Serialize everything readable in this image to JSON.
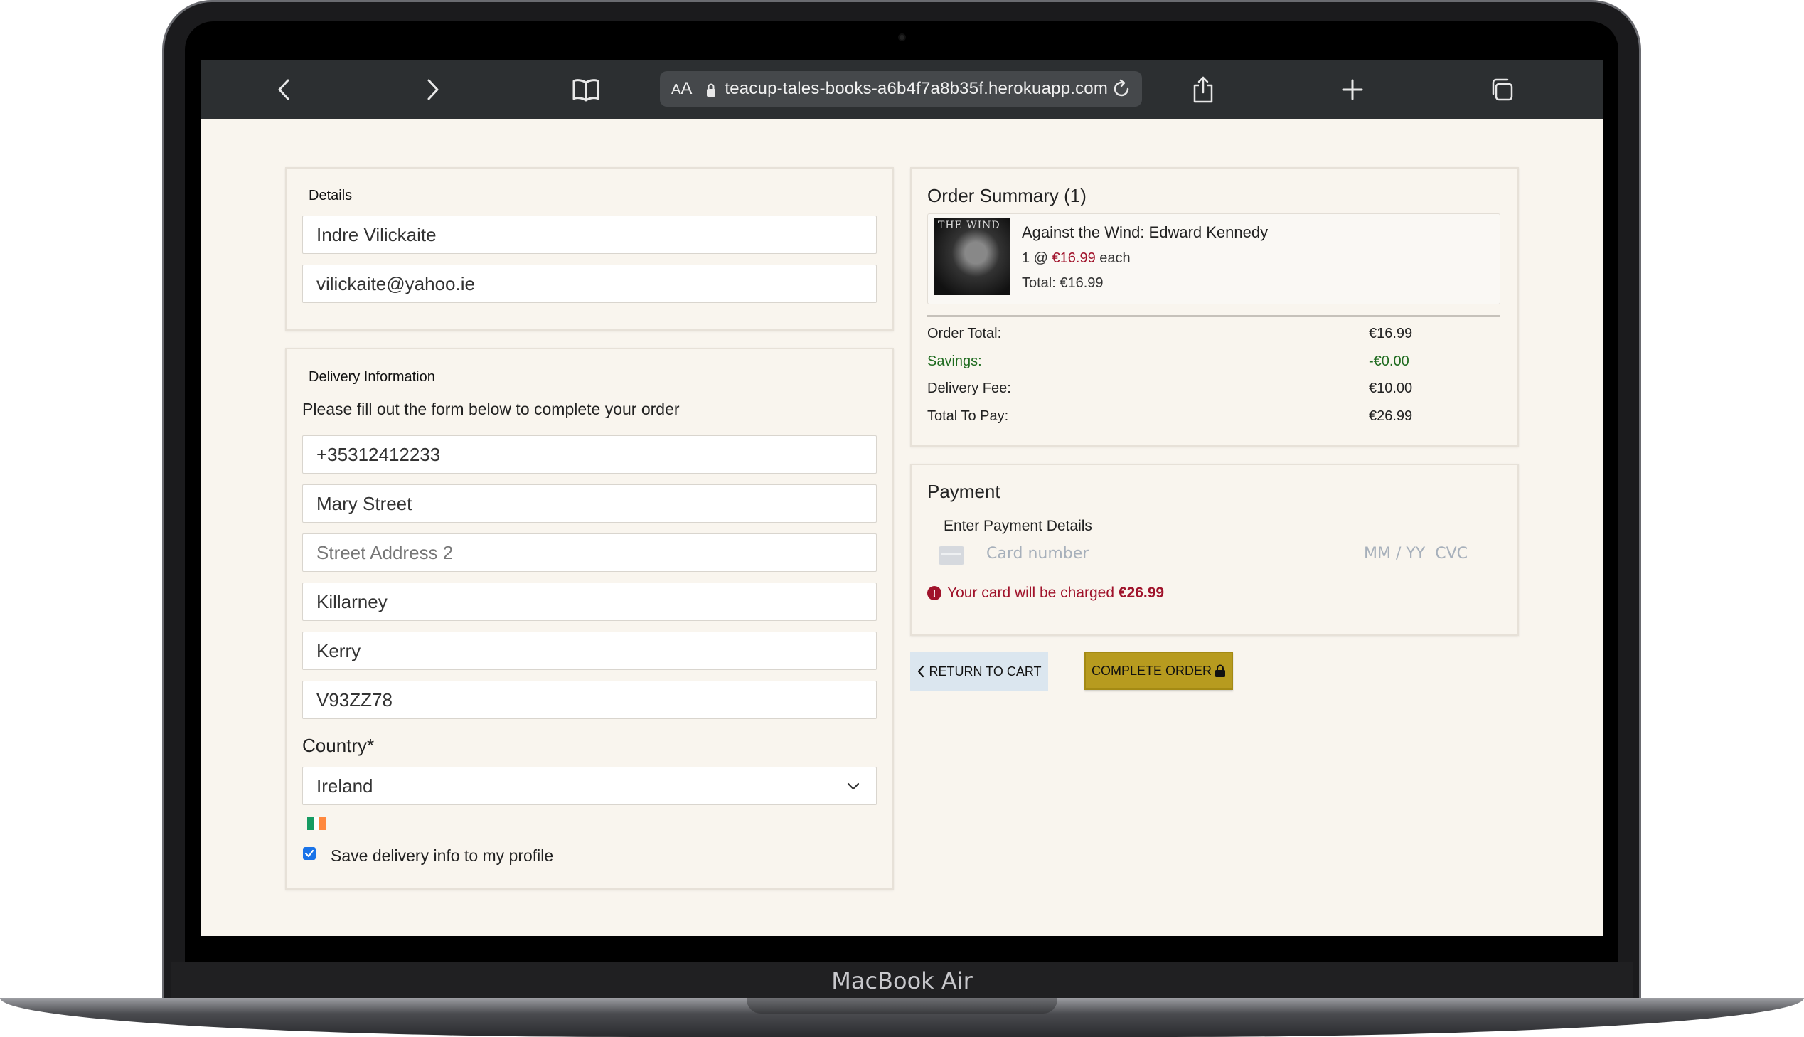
{
  "device": {
    "label": "MacBook Air"
  },
  "browser": {
    "aa_label_small": "A",
    "aa_label_big": "A",
    "url": "teacup-tales-books-a6b4f7a8b35f.herokuapp.com",
    "icons": [
      "back-icon",
      "forward-icon",
      "bookmarks-icon",
      "lock-icon",
      "reload-icon",
      "share-icon",
      "new-tab-icon",
      "tabs-icon"
    ]
  },
  "details": {
    "title": "Details",
    "full_name": "Indre Vilickaite",
    "email": "vilickaite@yahoo.ie"
  },
  "delivery": {
    "title": "Delivery Information",
    "instructions": "Please fill out the form below to complete your order",
    "phone": "+35312412233",
    "street1": "Mary Street",
    "street2_placeholder": "Street Address 2",
    "town": "Killarney",
    "county": "Kerry",
    "postcode": "V93ZZ78",
    "country_label": "Country*",
    "country_value": "Ireland",
    "save_label": "Save delivery info to my profile",
    "save_checked": true
  },
  "order_summary": {
    "title": "Order Summary (1)",
    "item": {
      "cover_title": "THE WIND",
      "name": "Against the Wind: Edward Kennedy",
      "quantity_prefix": "1 @",
      "unit_price": "€16.99",
      "each": "each",
      "total": "Total: €16.99"
    },
    "rows": [
      {
        "label": "Order Total:",
        "value": "€16.99"
      },
      {
        "label": "Savings:",
        "value": "-€0.00"
      },
      {
        "label": "Delivery Fee:",
        "value": "€10.00"
      },
      {
        "label": "Total To Pay:",
        "value": "€26.99"
      }
    ],
    "savings_color": "#1f6b1f"
  },
  "payment": {
    "title": "Payment",
    "subtitle": "Enter Payment Details",
    "card_number_placeholder": "Card number",
    "expiry_cvc_placeholder": "MM / YY  CVC",
    "charge_notice": "Your card will be charged",
    "charge_amount": "€26.99",
    "error_color": "#a0132b"
  },
  "actions": {
    "return_label": "Return to Cart",
    "complete_label": "Complete Order",
    "complete_color": "#b79b1f"
  }
}
